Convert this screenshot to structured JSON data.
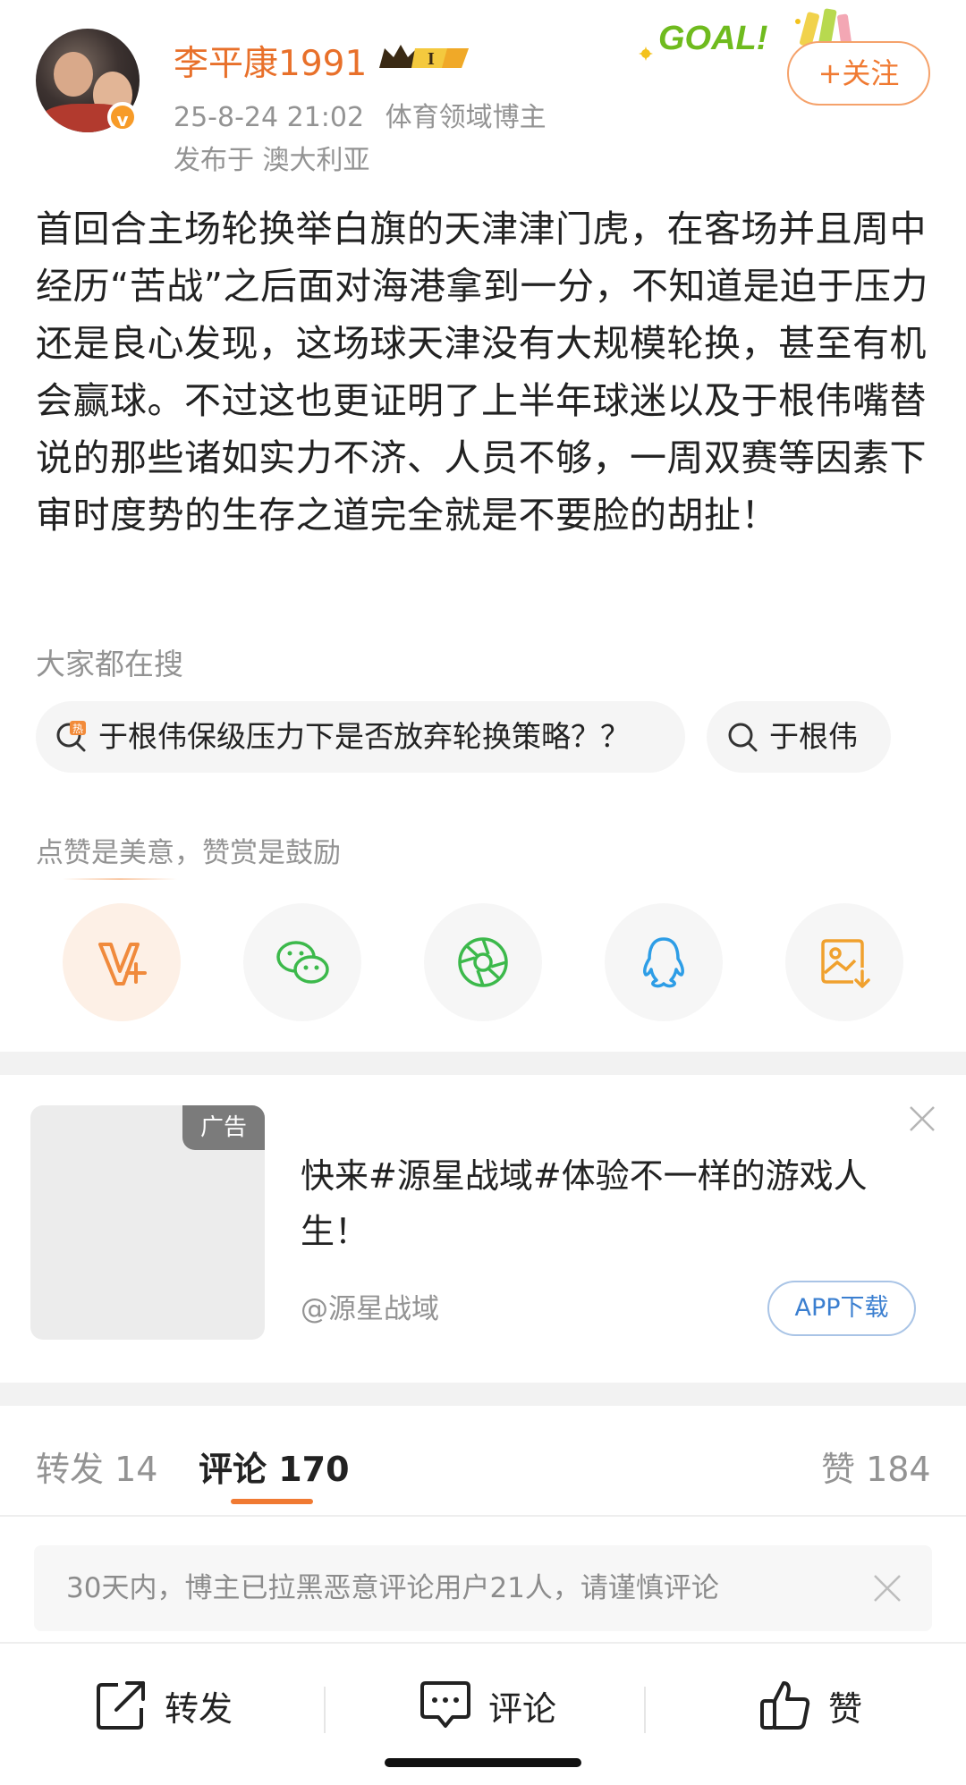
{
  "header": {
    "username": "李平康1991",
    "level_badge": "I",
    "date": "25-8-24 21:02",
    "category": "体育领域博主",
    "location": "发布于 澳大利亚",
    "follow_label": "+关注",
    "goal_text": "GOAL!",
    "verified_mark": "v"
  },
  "post": {
    "text": "首回合主场轮换举白旗的天津津门虎，在客场并且周中经历“苦战”之后面对海港拿到一分，不知道是迫于压力还是良心发现，这场球天津没有大规模轮换，甚至有机会赢球。不过这也更证明了上半年球迷以及于根伟嘴替说的那些诸如实力不济、人员不够，一周双赛等因素下审时度势的生存之道完全就是不要脸的胡扯！"
  },
  "search": {
    "title": "大家都在搜",
    "chips": [
      {
        "label": "于根伟保级压力下是否放弃轮换策略？？",
        "icon": "hot-search-icon"
      },
      {
        "label": "于根伟",
        "icon": "search-icon"
      }
    ]
  },
  "reward": {
    "title": "点赞是美意，赞赏是鼓励",
    "share_icons": [
      "reward-v-icon",
      "wechat-icon",
      "moments-icon",
      "qq-icon",
      "save-image-icon"
    ]
  },
  "ad": {
    "tag": "广告",
    "text": "快来#源星战域#体验不一样的游戏人生！",
    "source": "@源星战域",
    "button": "APP下载"
  },
  "tabs": {
    "repost": "转发 14",
    "comments": "评论 170",
    "likes": "赞 184"
  },
  "notice": {
    "text": "30天内，博主已拉黑恶意评论用户21人，请谨慎评论"
  },
  "bottom_bar": {
    "repost": "转发",
    "comment": "评论",
    "like": "赞"
  },
  "colors": {
    "accent": "#f07a32",
    "username": "#e8702a",
    "muted": "#939393"
  }
}
